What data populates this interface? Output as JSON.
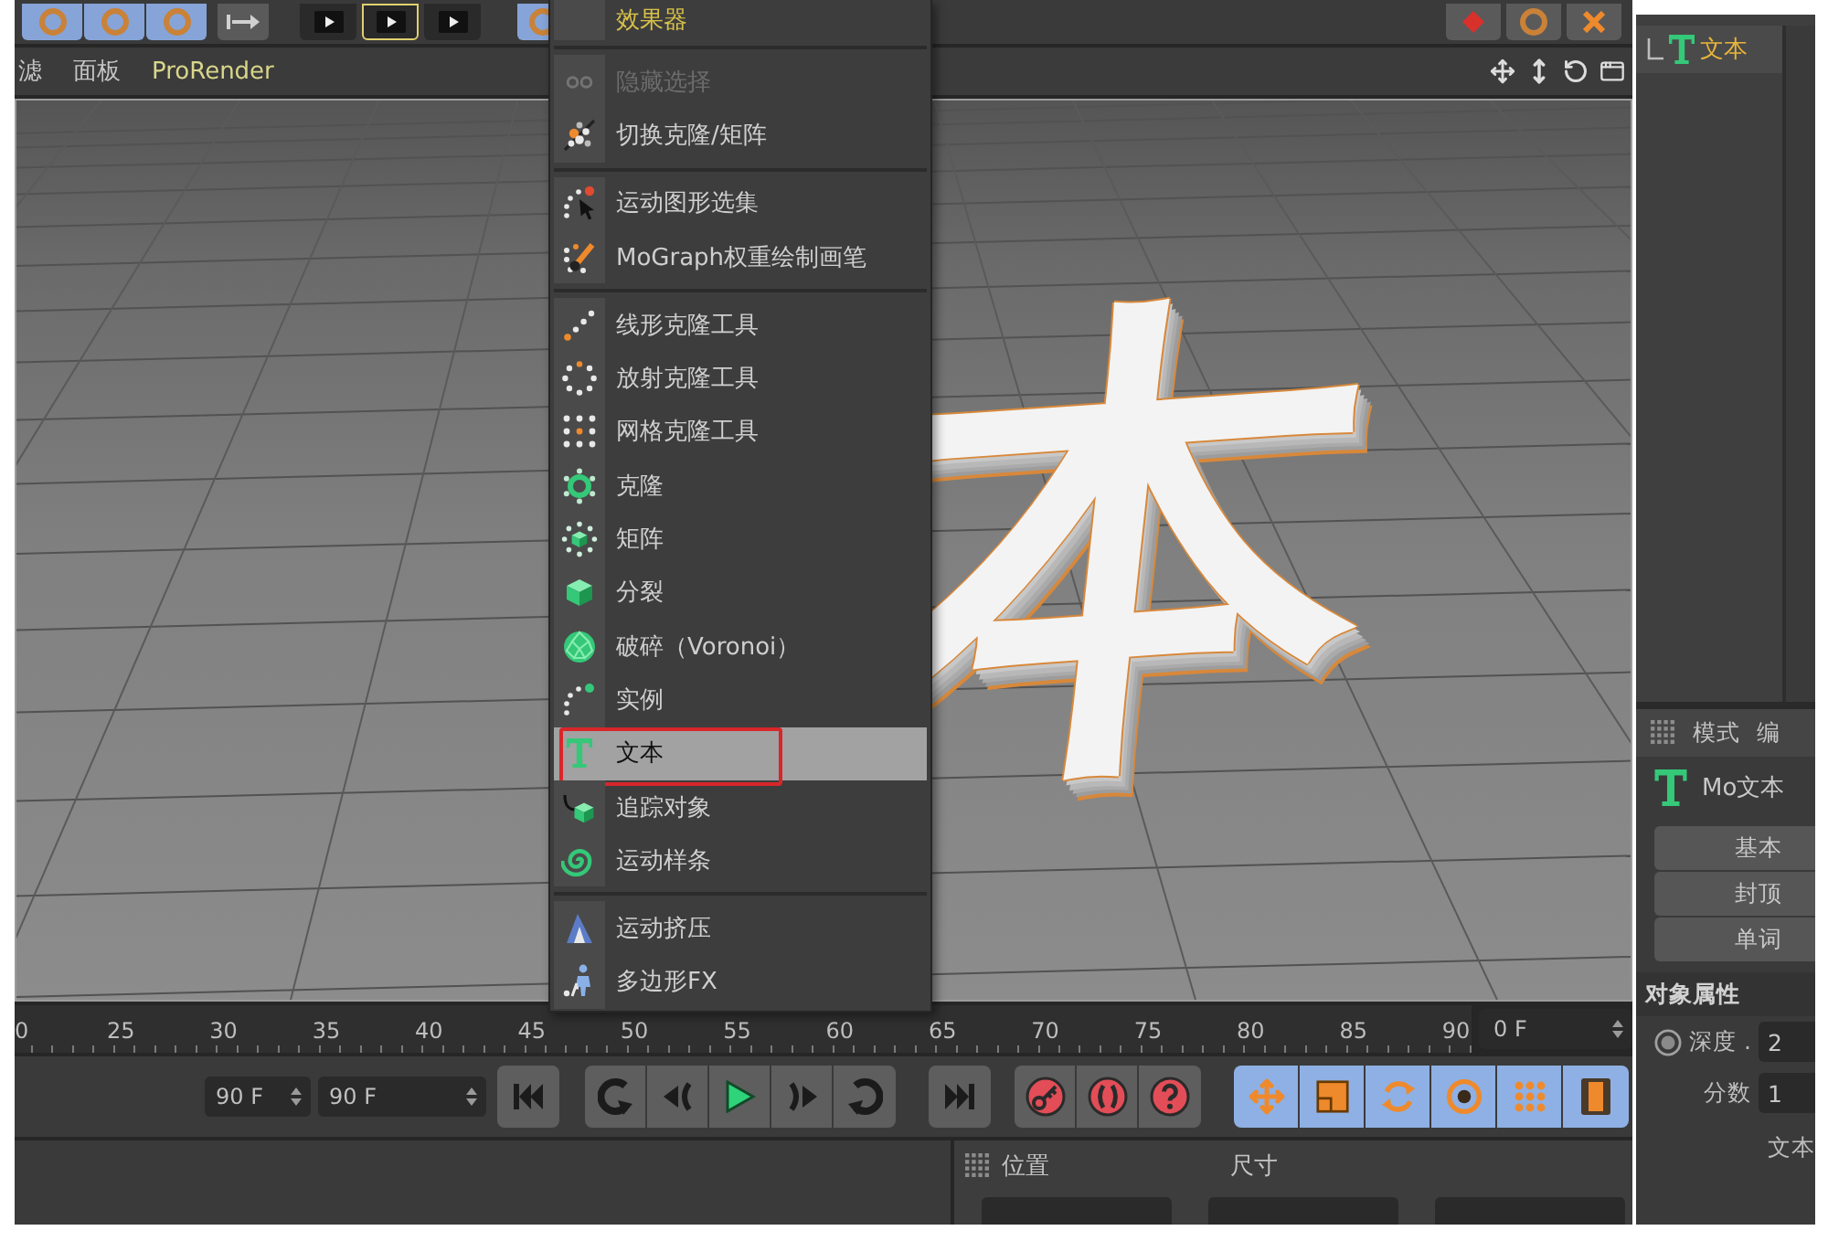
{
  "toolbar": {
    "film_buttons": [
      {
        "selected": false
      },
      {
        "selected": true
      },
      {
        "selected": false
      }
    ]
  },
  "viewport": {
    "menu": [
      {
        "label": "滤",
        "kind": "menu"
      },
      {
        "label": "面板",
        "kind": "menu"
      },
      {
        "label": "ProRender",
        "kind": "plugin"
      }
    ],
    "scene_text": "本"
  },
  "mograph_menu": {
    "groups": [
      {
        "items": [
          {
            "label": "效果器",
            "kind": "submenu",
            "disabled": false,
            "selected": false,
            "annotated": false
          }
        ]
      },
      {
        "items": [
          {
            "label": "隐藏选择",
            "kind": "command",
            "disabled": true,
            "selected": false,
            "annotated": false
          },
          {
            "label": "切换克隆/矩阵",
            "kind": "command",
            "disabled": false,
            "selected": false,
            "annotated": false
          }
        ]
      },
      {
        "items": [
          {
            "label": "运动图形选集",
            "kind": "command",
            "disabled": false,
            "selected": false,
            "annotated": false
          },
          {
            "label": "MoGraph权重绘制画笔",
            "kind": "command",
            "disabled": false,
            "selected": false,
            "annotated": false
          }
        ]
      },
      {
        "items": [
          {
            "label": "线形克隆工具",
            "kind": "command",
            "disabled": false,
            "selected": false,
            "annotated": false
          },
          {
            "label": "放射克隆工具",
            "kind": "command",
            "disabled": false,
            "selected": false,
            "annotated": false
          },
          {
            "label": "网格克隆工具",
            "kind": "command",
            "disabled": false,
            "selected": false,
            "annotated": false
          },
          {
            "label": "克隆",
            "kind": "command",
            "disabled": false,
            "selected": false,
            "annotated": false
          },
          {
            "label": "矩阵",
            "kind": "command",
            "disabled": false,
            "selected": false,
            "annotated": false
          },
          {
            "label": "分裂",
            "kind": "command",
            "disabled": false,
            "selected": false,
            "annotated": false
          },
          {
            "label": "破碎（Voronoi）",
            "kind": "command",
            "disabled": false,
            "selected": false,
            "annotated": false
          },
          {
            "label": "实例",
            "kind": "command",
            "disabled": false,
            "selected": false,
            "annotated": false
          },
          {
            "label": "文本",
            "kind": "command",
            "disabled": false,
            "selected": true,
            "annotated": true
          },
          {
            "label": "追踪对象",
            "kind": "command",
            "disabled": false,
            "selected": false,
            "annotated": false
          },
          {
            "label": "运动样条",
            "kind": "command",
            "disabled": false,
            "selected": false,
            "annotated": false
          }
        ]
      },
      {
        "items": [
          {
            "label": "运动挤压",
            "kind": "command",
            "disabled": false,
            "selected": false,
            "annotated": false
          },
          {
            "label": "多边形FX",
            "kind": "command",
            "disabled": false,
            "selected": false,
            "annotated": false
          }
        ]
      }
    ]
  },
  "object_manager": {
    "objects": [
      {
        "label": "文本",
        "selected": true
      }
    ]
  },
  "attribute_manager": {
    "menu": [
      "模式",
      "编"
    ],
    "object_label": "Mo文本",
    "tabs": [
      {
        "label": "基本",
        "selected": false
      },
      {
        "label": "封顶",
        "selected": false
      },
      {
        "label": "单词",
        "selected": false
      }
    ],
    "section_title": "对象属性",
    "fields": [
      {
        "label": "深度 .",
        "value": "2",
        "kind": "animatable"
      },
      {
        "label": "分数",
        "value": "1",
        "kind": "plain"
      }
    ],
    "text_label": "文本"
  },
  "timeline": {
    "ruler_labels": [
      "0",
      "25",
      "30",
      "35",
      "40",
      "45",
      "50",
      "55",
      "60",
      "65",
      "70",
      "75",
      "80",
      "85",
      "90"
    ],
    "current_frame": "0 F",
    "range_fields": [
      "90 F",
      "90 F"
    ]
  },
  "coordinates": {
    "columns": [
      "位置",
      "尺寸"
    ]
  }
}
